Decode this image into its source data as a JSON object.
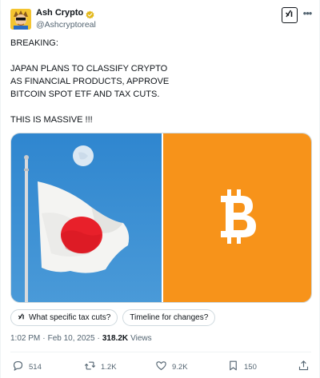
{
  "author": {
    "display_name": "Ash Crypto",
    "handle": "@Ashcryptoreal"
  },
  "tweet": {
    "paragraphs": [
      "BREAKING:",
      "JAPAN PLANS TO CLASSIFY CRYPTO\nAS FINANCIAL PRODUCTS, APPROVE\nBITCOIN SPOT ETF AND TAX CUTS.",
      "THIS IS MASSIVE !!!"
    ]
  },
  "suggestions": [
    "What specific tax cuts?",
    "Timeline for changes?"
  ],
  "meta": {
    "time": "1:02 PM",
    "date": "Feb 10, 2025",
    "views_count": "318.2K",
    "views_label": "Views"
  },
  "actions": {
    "replies": "514",
    "reposts": "1.2K",
    "likes": "9.2K",
    "bookmarks": "150"
  },
  "colors": {
    "text": "#0f1419",
    "secondary": "#536471",
    "sky": "#3a8fd1",
    "bitcoin_orange": "#f7931a",
    "flag_red": "#e8202a",
    "verified_gold": "#e2b719"
  },
  "icons": [
    "grok-icon",
    "more-icon",
    "verified-badge-icon",
    "sparkle-icon",
    "reply-icon",
    "repost-icon",
    "like-icon",
    "bookmark-icon",
    "share-icon",
    "bitcoin-icon"
  ]
}
